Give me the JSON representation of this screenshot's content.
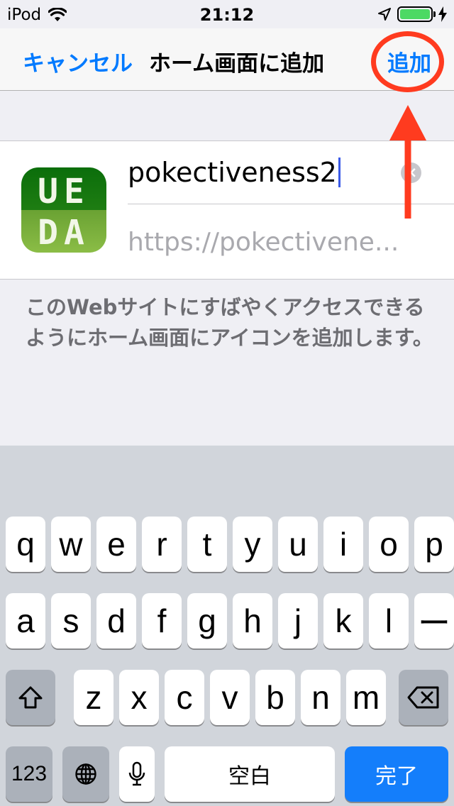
{
  "status_bar": {
    "carrier": "iPod",
    "time": "21:12"
  },
  "nav": {
    "cancel_label": "キャンセル",
    "title": "ホーム画面に追加",
    "add_label": "追加"
  },
  "form": {
    "icon_letters_top": "UE",
    "icon_letters_bottom": "DA",
    "name_value": "pokectiveness2",
    "url_text": "https://pokectivene...",
    "clear_glyph": "×"
  },
  "description": "このWebサイトにすばやくアクセスできるようにホーム画面にアイコンを追加します。",
  "annotation": {
    "circle_color": "#ff3b1f",
    "arrow_color": "#ff3b1f"
  },
  "keyboard": {
    "row1": [
      "q",
      "w",
      "e",
      "r",
      "t",
      "y",
      "u",
      "i",
      "o",
      "p"
    ],
    "row2": [
      "a",
      "s",
      "d",
      "f",
      "g",
      "h",
      "j",
      "k",
      "l",
      "ー"
    ],
    "row3": [
      "z",
      "x",
      "c",
      "v",
      "b",
      "n",
      "m"
    ],
    "numbers_label": "123",
    "space_label": "空白",
    "done_label": "完了"
  }
}
